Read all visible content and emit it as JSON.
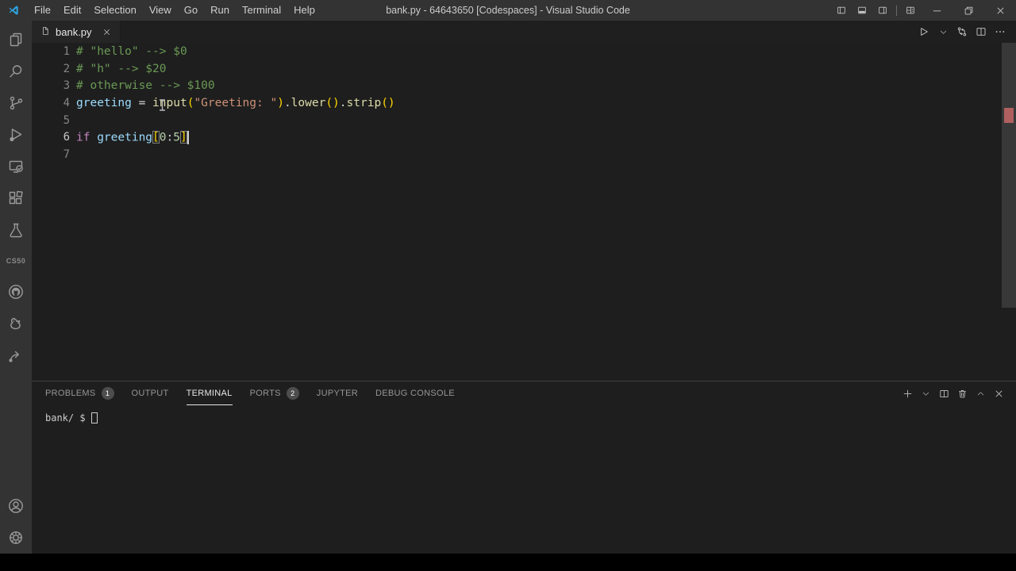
{
  "window": {
    "title": "bank.py - 64643650 [Codespaces] - Visual Studio Code"
  },
  "menu": {
    "items": [
      "File",
      "Edit",
      "Selection",
      "View",
      "Go",
      "Run",
      "Terminal",
      "Help"
    ]
  },
  "window_controls": [
    {
      "name": "toggle-primary-sidebar",
      "icon": "layout-left"
    },
    {
      "name": "toggle-panel",
      "icon": "layout-panel"
    },
    {
      "name": "toggle-secondary-sidebar",
      "icon": "layout-right"
    },
    {
      "name": "sep",
      "icon": "sep"
    },
    {
      "name": "customize-layout",
      "icon": "layout-custom"
    },
    {
      "name": "minimize-window",
      "icon": "minimize",
      "wide": true
    },
    {
      "name": "restore-window",
      "icon": "restore",
      "wide": true
    },
    {
      "name": "close-window",
      "icon": "close",
      "wide": true
    }
  ],
  "activity_bar": {
    "top": [
      {
        "name": "explorer",
        "icon": "files"
      },
      {
        "name": "search",
        "icon": "search"
      },
      {
        "name": "source-control",
        "icon": "source-control"
      },
      {
        "name": "run-and-debug",
        "icon": "debug"
      },
      {
        "name": "remote-explorer",
        "icon": "remote"
      },
      {
        "name": "extensions",
        "icon": "extensions"
      },
      {
        "name": "testing",
        "icon": "beaker"
      }
    ],
    "label": "CS50",
    "mid": [
      {
        "name": "github",
        "icon": "github"
      },
      {
        "name": "cs50-duck-debugger",
        "icon": "duck"
      },
      {
        "name": "share",
        "icon": "share"
      }
    ],
    "bottom": [
      {
        "name": "accounts",
        "icon": "account"
      },
      {
        "name": "settings",
        "icon": "gear"
      }
    ]
  },
  "editor": {
    "tab": {
      "label": "bank.py"
    },
    "actions": [
      {
        "name": "run-python-file",
        "icon": "run"
      },
      {
        "name": "run-dropdown",
        "icon": "chevron-down",
        "small": true
      },
      {
        "name": "open-changes",
        "icon": "compare"
      },
      {
        "name": "split-editor",
        "icon": "split"
      },
      {
        "name": "more-actions",
        "icon": "more"
      }
    ],
    "lines": [
      {
        "num": "1",
        "tokens": [
          [
            "comment",
            "# \"hello\" --> $0"
          ]
        ]
      },
      {
        "num": "2",
        "tokens": [
          [
            "comment",
            "# \"h\" --> $20"
          ]
        ]
      },
      {
        "num": "3",
        "tokens": [
          [
            "comment",
            "# otherwise --> $100"
          ]
        ]
      },
      {
        "num": "4",
        "tokens": [
          [
            "variable",
            "greeting"
          ],
          [
            "plain",
            " = "
          ],
          [
            "function",
            "input"
          ],
          [
            "bracket",
            "("
          ],
          [
            "string",
            "\"Greeting: \""
          ],
          [
            "bracket",
            ")"
          ],
          [
            "plain",
            "."
          ],
          [
            "function",
            "lower"
          ],
          [
            "bracket",
            "()"
          ],
          [
            "plain",
            "."
          ],
          [
            "function",
            "strip"
          ],
          [
            "bracket",
            "()"
          ]
        ]
      },
      {
        "num": "5",
        "tokens": []
      },
      {
        "num": "6",
        "active": true,
        "tokens": [
          [
            "keyword",
            "if"
          ],
          [
            "plain",
            " "
          ],
          [
            "variable",
            "greeting"
          ],
          [
            "bracket-match",
            "["
          ],
          [
            "number",
            "0"
          ],
          [
            "plain",
            ":"
          ],
          [
            "number",
            "5"
          ],
          [
            "bracket-match",
            "]"
          ],
          [
            "cursor",
            ""
          ]
        ]
      },
      {
        "num": "7",
        "tokens": []
      }
    ]
  },
  "panel": {
    "tabs": [
      {
        "label": "PROBLEMS",
        "badge": "1"
      },
      {
        "label": "OUTPUT"
      },
      {
        "label": "TERMINAL",
        "active": true
      },
      {
        "label": "PORTS",
        "badge": "2"
      },
      {
        "label": "JUPYTER"
      },
      {
        "label": "DEBUG CONSOLE"
      }
    ],
    "actions": [
      {
        "name": "new-terminal",
        "icon": "plus"
      },
      {
        "name": "terminal-dropdown",
        "icon": "chevron-down",
        "small": true
      },
      {
        "name": "split-terminal",
        "icon": "split"
      },
      {
        "name": "kill-terminal",
        "icon": "trash"
      },
      {
        "name": "maximize-panel",
        "icon": "chevron-up",
        "small": true
      },
      {
        "name": "close-panel",
        "icon": "close"
      }
    ],
    "terminal": {
      "prompt": "bank/ $"
    }
  },
  "colors": {
    "comment": "#6a9955",
    "variable": "#9cdcfe",
    "function": "#dcdcaa",
    "string": "#ce9178",
    "keyword": "#c586c0",
    "number": "#b5cea8",
    "plain": "#d4d4d4",
    "bracket": "#ffd700",
    "line_number": "#858585",
    "active_line_number": "#c6c6c6",
    "badge_bg": "#4d4d4d",
    "error_marker": "#b0605f",
    "titlebar_bg": "#333333",
    "activitybar_bg": "#333333",
    "editor_bg": "#1e1e1e",
    "tab_bg": "#252526",
    "tabstrip_bg": "#1f1f1f",
    "panel_tab_active": "#e7e7e7",
    "panel_tab_inactive": "#969696",
    "terminal_text": "#cccccc",
    "logo_blue": "#2da4e0"
  }
}
